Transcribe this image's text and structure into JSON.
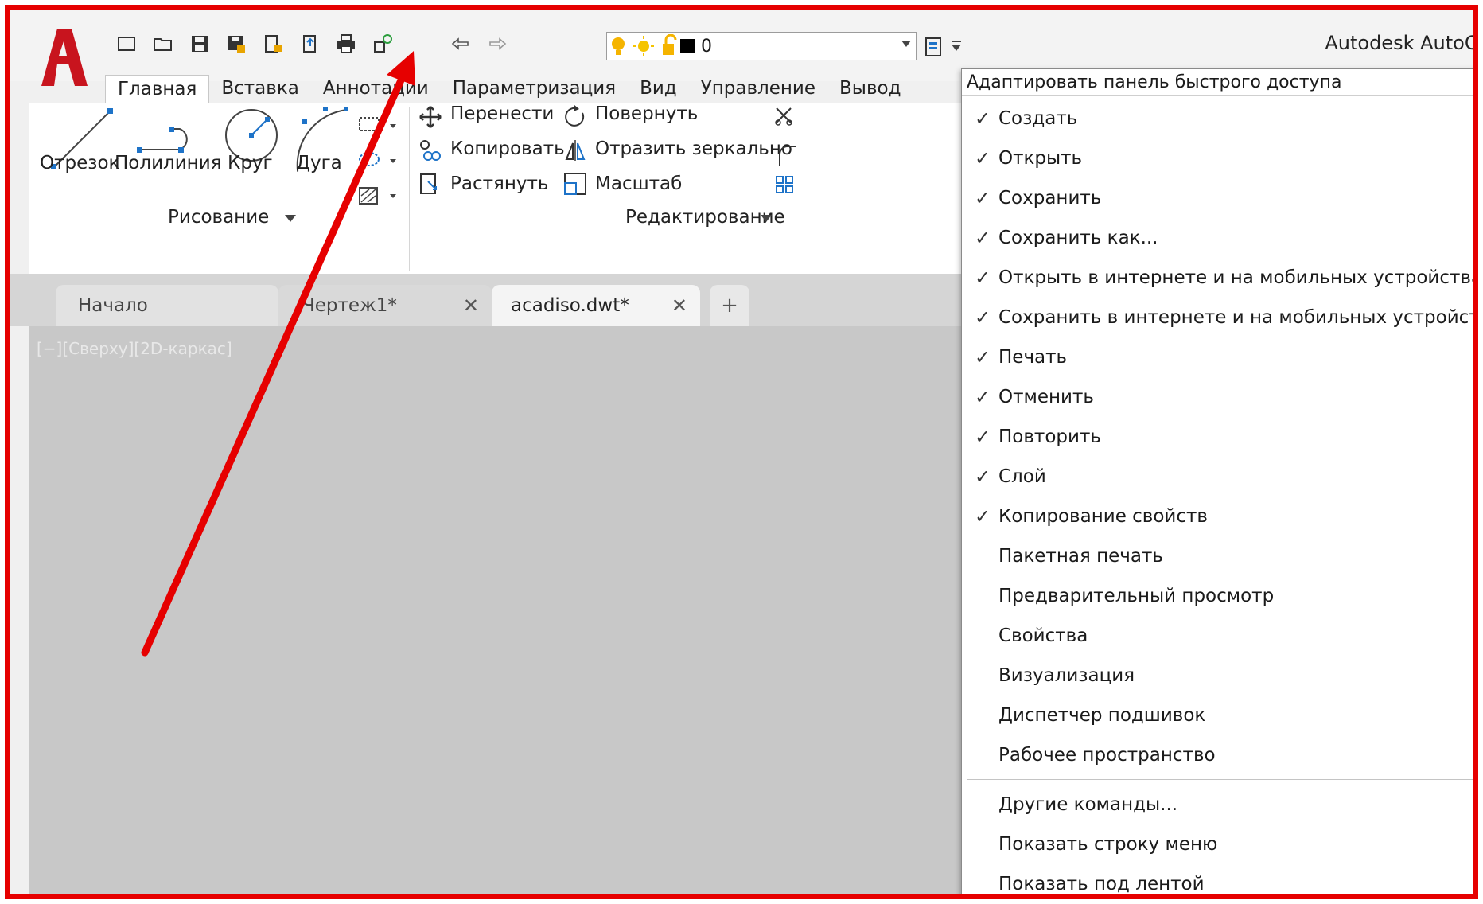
{
  "app": {
    "title": "Autodesk AutoCA",
    "layer_value": "0"
  },
  "ribbon_tabs": [
    "Главная",
    "Вставка",
    "Аннотации",
    "Параметризация",
    "Вид",
    "Управление",
    "Вывод"
  ],
  "draw_panel": {
    "title": "Рисование",
    "tools": [
      "Отрезок",
      "Полилиния",
      "Круг",
      "Дуга"
    ]
  },
  "modify_panel": {
    "title": "Редактирование",
    "tools": [
      "Перенести",
      "Копировать",
      "Растянуть",
      "Повернуть",
      "Отразить зеркально",
      "Масштаб"
    ]
  },
  "doc_tabs": {
    "start": "Начало",
    "drawing1": "Чертеж1*",
    "acadiso": "acadiso.dwt*",
    "close": "✕",
    "add": "+"
  },
  "viewport_label": "[−][Сверху][2D-каркас]",
  "qat_menu": {
    "header": "Адаптировать панель быстрого доступа",
    "check_symbol": "✓",
    "items": [
      {
        "label": "Создать",
        "checked": true
      },
      {
        "label": "Открыть",
        "checked": true
      },
      {
        "label": "Сохранить",
        "checked": true
      },
      {
        "label": "Сохранить как...",
        "checked": true
      },
      {
        "label": "Открыть в интернете и на мобильных устройствах",
        "checked": true
      },
      {
        "label": "Сохранить в интернете и на мобильных устройствах",
        "checked": true
      },
      {
        "label": "Печать",
        "checked": true
      },
      {
        "label": "Отменить",
        "checked": true
      },
      {
        "label": "Повторить",
        "checked": true
      },
      {
        "label": "Слой",
        "checked": true
      },
      {
        "label": "Копирование свойств",
        "checked": true
      },
      {
        "label": "Пакетная печать",
        "checked": false
      },
      {
        "label": "Предварительный просмотр",
        "checked": false
      },
      {
        "label": "Свойства",
        "checked": false
      },
      {
        "label": "Визуализация",
        "checked": false
      },
      {
        "label": "Диспетчер подшивок",
        "checked": false
      },
      {
        "label": "Рабочее пространство",
        "checked": false
      }
    ],
    "extra_items": [
      "Другие команды...",
      "Показать строку меню",
      "Показать под лентой"
    ]
  },
  "colors": {
    "accent_red": "#e60000",
    "icon_blue": "#1e73c8",
    "viewport_bg": "#c8c8c8"
  }
}
